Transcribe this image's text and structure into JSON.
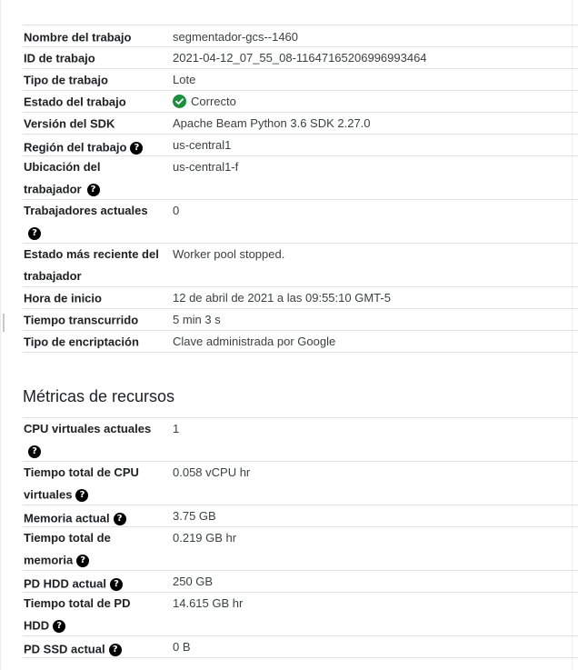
{
  "job_info": {
    "rows": [
      {
        "label": "Nombre del trabajo",
        "value": "segmentador-gcs--1460"
      },
      {
        "label": "ID de trabajo",
        "value": "2021-04-12_07_55_08-11647165206996993464"
      },
      {
        "label": "Tipo de trabajo",
        "value": "Lote"
      },
      {
        "label": "Estado del trabajo",
        "value": "Correcto",
        "status_icon": "check-circle-icon",
        "status_color": "#1e8e3e"
      },
      {
        "label": "Versión del SDK",
        "value": "Apache Beam Python 3.6 SDK 2.27.0"
      },
      {
        "label": "Región del trabajo",
        "value": "us-central1",
        "help": true
      },
      {
        "label_line1": "Ubicación del",
        "label_line2": "trabajador",
        "value": "us-central1-f",
        "help": true
      },
      {
        "label_line1": "Trabajadores actuales",
        "label_line2": "",
        "value": "0",
        "help": true
      },
      {
        "label_line1": "Estado más reciente del",
        "label_line2": "trabajador",
        "value": "Worker pool stopped."
      },
      {
        "label": "Hora de inicio",
        "value": "12 de abril de 2021 a las 09:55:10 GMT-5"
      },
      {
        "label": "Tiempo transcurrido",
        "value": "5 min 3 s"
      },
      {
        "label": "Tipo de encriptación",
        "value": "Clave administrada por Google"
      }
    ]
  },
  "resources": {
    "title": "Métricas de recursos",
    "rows": [
      {
        "label_line1": "CPU virtuales actuales",
        "label_line2": "",
        "value": "1",
        "help": true
      },
      {
        "label_line1": "Tiempo total de CPU",
        "label_line2": "virtuales",
        "value": "0.058 vCPU hr",
        "help": true
      },
      {
        "label": "Memoria actual",
        "value": "3.75 GB",
        "help": true
      },
      {
        "label_line1": "Tiempo total de",
        "label_line2": "memoria",
        "value": "0.219 GB hr",
        "help": true
      },
      {
        "label": "PD HDD actual",
        "value": "250 GB",
        "help": true
      },
      {
        "label_line1": "Tiempo total de PD",
        "label_line2": "HDD",
        "value": "14.615 GB hr",
        "help": true
      },
      {
        "label": "PD SSD actual",
        "value": "0 B",
        "help": true
      }
    ]
  },
  "icons": {
    "help": "help-circle-icon",
    "help_glyph": "?"
  },
  "colors": {
    "success": "#1e8e3e",
    "divider": "#e0e0e0",
    "label": "#202124",
    "value": "#3c4043"
  }
}
